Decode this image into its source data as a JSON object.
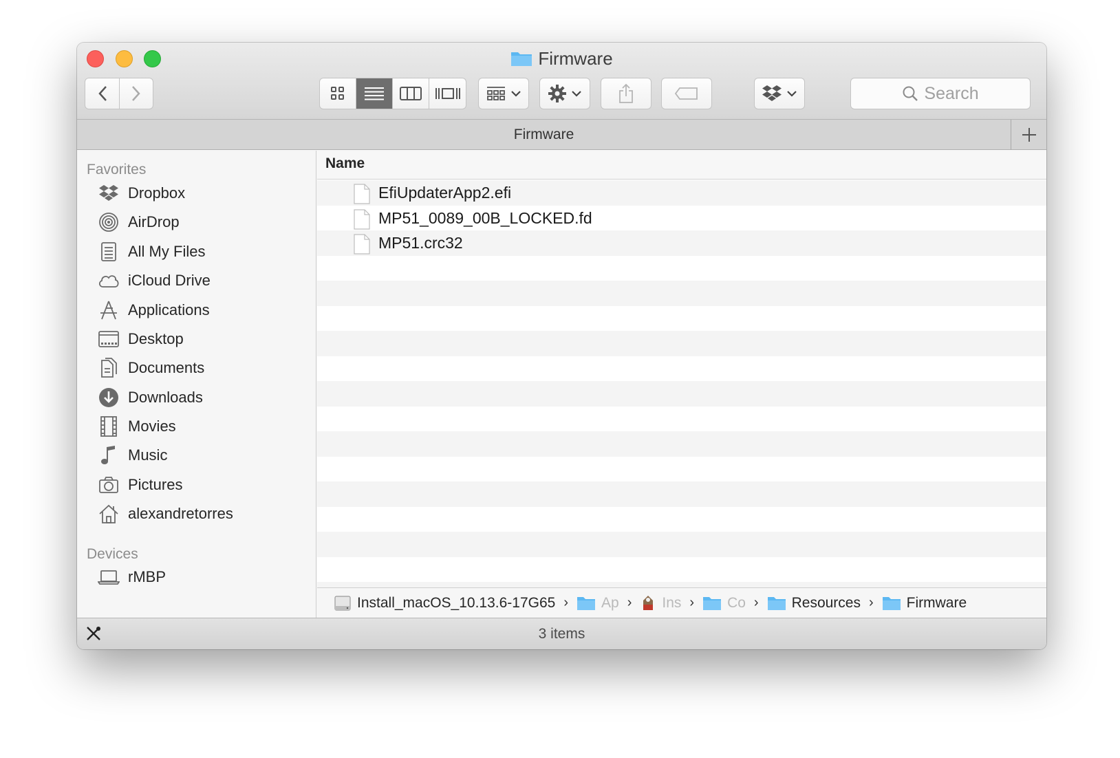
{
  "window": {
    "title": "Firmware",
    "tab_title": "Firmware",
    "status": "3 items"
  },
  "toolbar": {
    "search_placeholder": "Search",
    "view_modes": [
      "icon-view",
      "list-view",
      "column-view",
      "cover-flow-view"
    ],
    "active_view": "list-view"
  },
  "sidebar": {
    "favorites_label": "Favorites",
    "devices_label": "Devices",
    "favorites": [
      {
        "label": "Dropbox",
        "icon": "dropbox-icon"
      },
      {
        "label": "AirDrop",
        "icon": "airdrop-icon"
      },
      {
        "label": "All My Files",
        "icon": "all-my-files-icon"
      },
      {
        "label": "iCloud Drive",
        "icon": "icloud-icon"
      },
      {
        "label": "Applications",
        "icon": "applications-icon"
      },
      {
        "label": "Desktop",
        "icon": "desktop-icon"
      },
      {
        "label": "Documents",
        "icon": "documents-icon"
      },
      {
        "label": "Downloads",
        "icon": "downloads-icon"
      },
      {
        "label": "Movies",
        "icon": "movies-icon"
      },
      {
        "label": "Music",
        "icon": "music-icon"
      },
      {
        "label": "Pictures",
        "icon": "pictures-icon"
      },
      {
        "label": "alexandretorres",
        "icon": "home-icon"
      }
    ],
    "devices": [
      {
        "label": "rMBP",
        "icon": "laptop-icon"
      }
    ]
  },
  "list": {
    "column_name": "Name",
    "files": [
      {
        "name": "EfiUpdaterApp2.efi"
      },
      {
        "name": "MP51_0089_00B_LOCKED.fd"
      },
      {
        "name": "MP51.crc32"
      }
    ]
  },
  "pathbar": {
    "crumbs": [
      {
        "label": "Install_macOS_10.13.6-17G65",
        "icon": "disk-icon"
      },
      {
        "label": "Ap",
        "icon": "folder-icon"
      },
      {
        "label": "Ins",
        "icon": "installer-icon"
      },
      {
        "label": "Co",
        "icon": "folder-icon"
      },
      {
        "label": "Resources",
        "icon": "folder-icon"
      },
      {
        "label": "Firmware",
        "icon": "folder-icon"
      }
    ]
  },
  "colors": {
    "folder_blue": "#5cb8f2",
    "close": "#fc605c",
    "minimize": "#fdbc40",
    "zoom": "#34c84a"
  }
}
